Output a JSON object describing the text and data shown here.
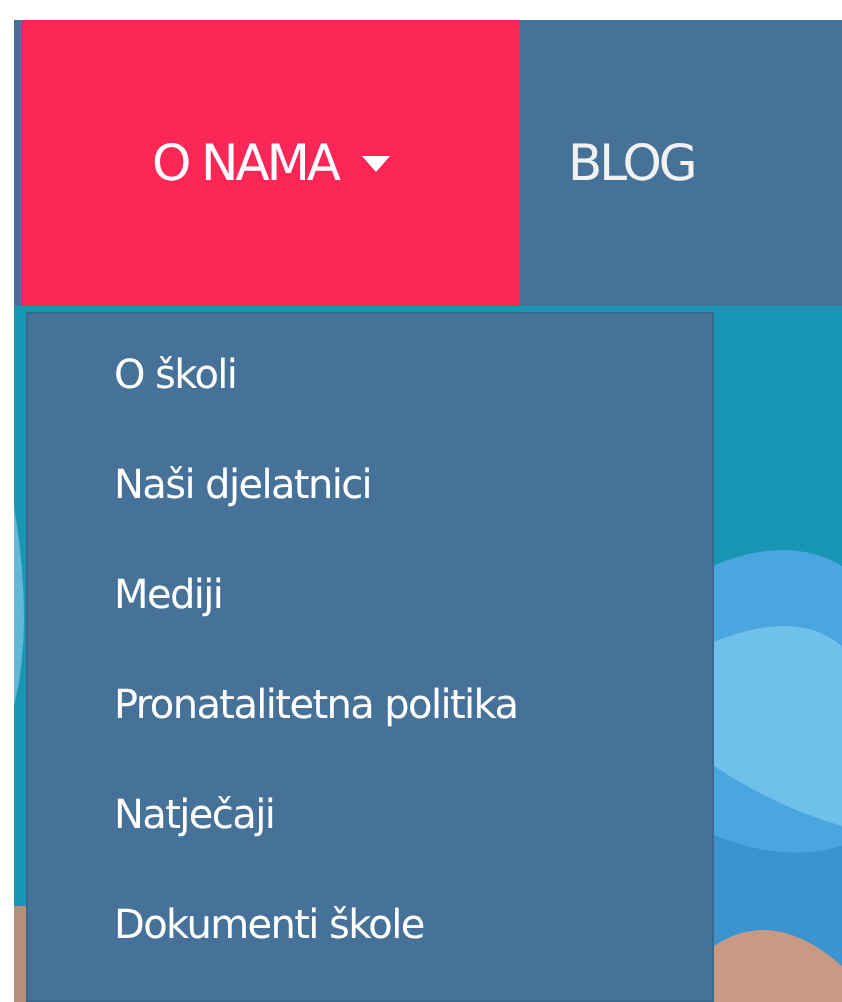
{
  "nav": {
    "items": [
      {
        "label": "O NAMA",
        "selected": true,
        "dropdown": true
      },
      {
        "label": "BLOG",
        "selected": false,
        "dropdown": false
      }
    ]
  },
  "dropdown_menu": {
    "items": [
      {
        "label": "O školi"
      },
      {
        "label": "Naši djelatnici"
      },
      {
        "label": "Mediji"
      },
      {
        "label": "Pronatalitetna politika"
      },
      {
        "label": "Natječaji"
      },
      {
        "label": "Dokumenti škole"
      }
    ]
  }
}
